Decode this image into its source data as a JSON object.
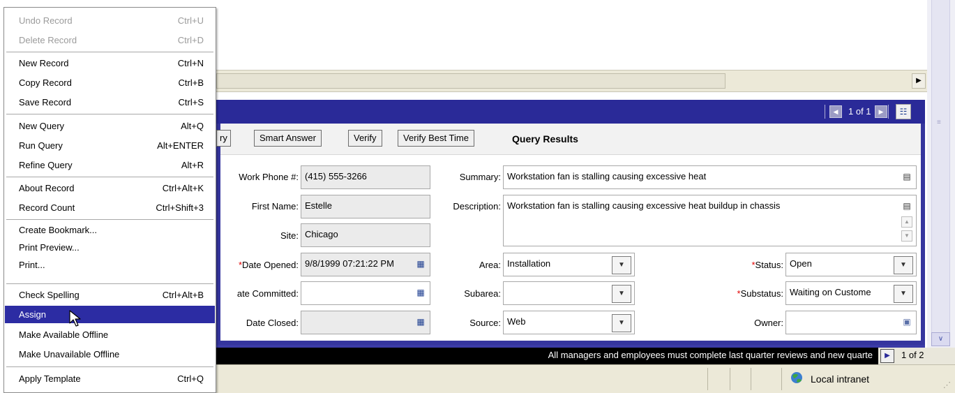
{
  "menu": {
    "items": [
      {
        "label": "Undo Record",
        "shortcut": "Ctrl+U",
        "disabled": true
      },
      {
        "label": "Delete Record",
        "shortcut": "Ctrl+D",
        "disabled": true
      },
      {
        "label": "New Record",
        "shortcut": "Ctrl+N"
      },
      {
        "label": "Copy Record",
        "shortcut": "Ctrl+B"
      },
      {
        "label": "Save Record",
        "shortcut": "Ctrl+S"
      },
      {
        "label": "New Query",
        "shortcut": "Alt+Q"
      },
      {
        "label": "Run Query",
        "shortcut": "Alt+ENTER"
      },
      {
        "label": "Refine Query",
        "shortcut": "Alt+R"
      },
      {
        "label": "About Record",
        "shortcut": "Ctrl+Alt+K"
      },
      {
        "label": "Record Count",
        "shortcut": "Ctrl+Shift+3"
      },
      {
        "label": "Create Bookmark...",
        "shortcut": ""
      },
      {
        "label": "Print Preview...",
        "shortcut": ""
      },
      {
        "label": "Print...",
        "shortcut": ""
      },
      {
        "label": "Check Spelling",
        "shortcut": "Ctrl+Alt+B"
      },
      {
        "label": "Assign",
        "shortcut": "",
        "highlighted": true
      },
      {
        "label": "Make Available Offline",
        "shortcut": ""
      },
      {
        "label": "Make Unavailable Offline",
        "shortcut": ""
      },
      {
        "label": "Apply Template",
        "shortcut": "Ctrl+Q"
      }
    ]
  },
  "applet": {
    "pager": "1 of 1",
    "buttons": {
      "partial": "ry",
      "smart_answer": "Smart Answer",
      "verify": "Verify",
      "verify_best_time": "Verify Best Time"
    },
    "query_results": "Query Results"
  },
  "form": {
    "work_phone": {
      "label": "Work Phone #:",
      "value": "(415) 555-3266"
    },
    "first_name": {
      "label": "First Name:",
      "value": "Estelle"
    },
    "site": {
      "label": "Site:",
      "value": "Chicago"
    },
    "date_opened": {
      "label": "Date Opened:",
      "value": "9/8/1999 07:21:22 PM"
    },
    "date_committed": {
      "label": "ate Committed:",
      "value": ""
    },
    "date_closed": {
      "label": "Date Closed:",
      "value": ""
    },
    "summary": {
      "label": "Summary:",
      "value": "Workstation fan is stalling causing excessive heat"
    },
    "description": {
      "label": "Description:",
      "value": "Workstation fan is stalling causing excessive heat buildup in chassis"
    },
    "area": {
      "label": "Area:",
      "value": "Installation"
    },
    "subarea": {
      "label": "Subarea:",
      "value": ""
    },
    "source": {
      "label": "Source:",
      "value": "Web"
    },
    "status": {
      "label": "Status:",
      "value": "Open"
    },
    "substatus": {
      "label": "Substatus:",
      "value": "Waiting on Custome"
    },
    "owner": {
      "label": "Owner:",
      "value": ""
    }
  },
  "ticker": {
    "text": "All managers and employees must complete last quarter reviews and new quarte",
    "count": "1 of 2"
  },
  "statusbar": {
    "zone": "Local intranet"
  },
  "colors": {
    "accent": "#2A2A98",
    "highlight": "#2C2CA3",
    "required": "#E00000"
  }
}
